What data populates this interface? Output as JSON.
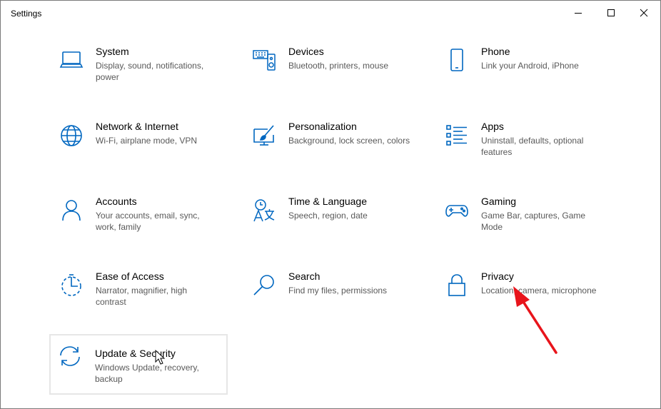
{
  "window": {
    "title": "Settings",
    "controls": [
      "minimize",
      "maximize",
      "close"
    ]
  },
  "categories": [
    {
      "name": "System",
      "desc": "Display, sound, notifications, power",
      "icon": "laptop-icon"
    },
    {
      "name": "Devices",
      "desc": "Bluetooth, printers, mouse",
      "icon": "keyboard-speaker-icon"
    },
    {
      "name": "Phone",
      "desc": "Link your Android, iPhone",
      "icon": "phone-icon"
    },
    {
      "name": "Network & Internet",
      "desc": "Wi-Fi, airplane mode, VPN",
      "icon": "globe-icon"
    },
    {
      "name": "Personalization",
      "desc": "Background, lock screen, colors",
      "icon": "paintbrush-icon"
    },
    {
      "name": "Apps",
      "desc": "Uninstall, defaults, optional features",
      "icon": "apps-list-icon"
    },
    {
      "name": "Accounts",
      "desc": "Your accounts, email, sync, work, family",
      "icon": "person-icon"
    },
    {
      "name": "Time & Language",
      "desc": "Speech, region, date",
      "icon": "time-language-icon"
    },
    {
      "name": "Gaming",
      "desc": "Game Bar, captures, Game Mode",
      "icon": "gamepad-icon"
    },
    {
      "name": "Ease of Access",
      "desc": "Narrator, magnifier, high contrast",
      "icon": "ease-of-access-icon"
    },
    {
      "name": "Search",
      "desc": "Find my files, permissions",
      "icon": "search-icon"
    },
    {
      "name": "Privacy",
      "desc": "Location, camera, microphone",
      "icon": "lock-icon"
    },
    {
      "name": "Update & Security",
      "desc": "Windows Update, recovery, backup",
      "icon": "sync-icon"
    }
  ],
  "colors": {
    "accent": "#0067c0",
    "annotation_arrow": "#e8141b",
    "description_text": "#595959"
  }
}
